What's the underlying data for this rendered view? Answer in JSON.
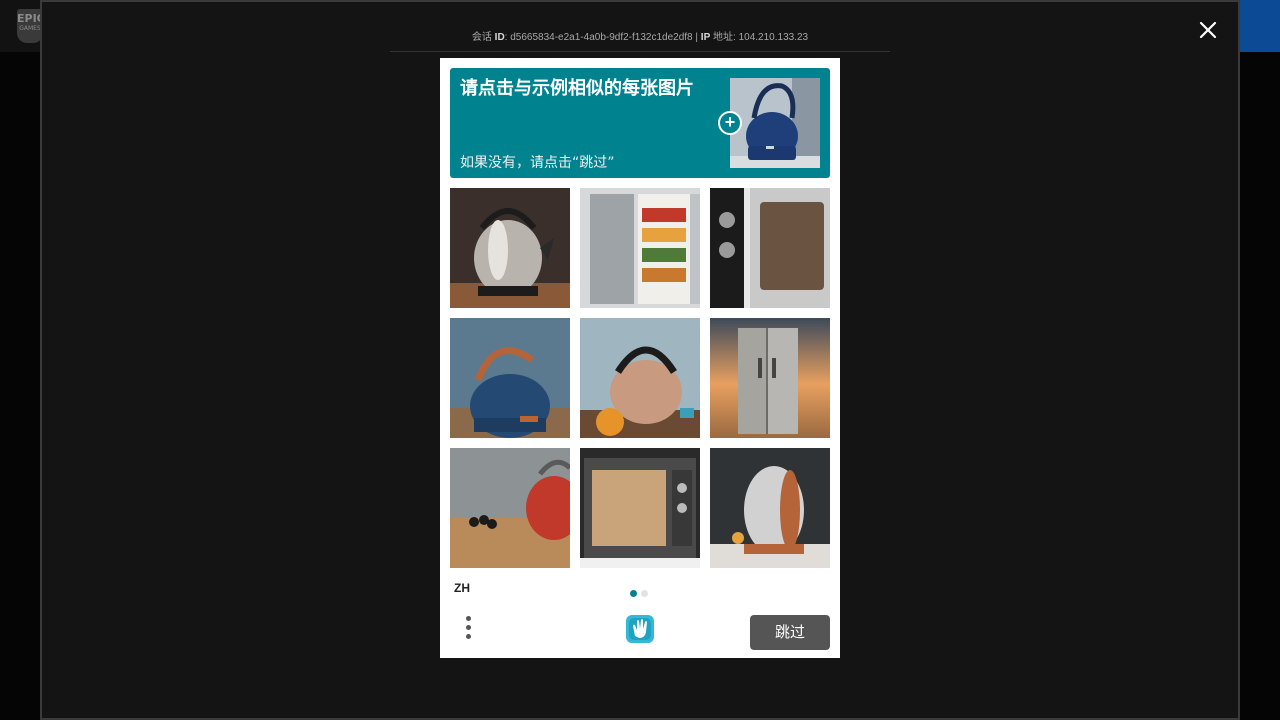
{
  "app": {
    "logo_text": "EPIC",
    "logo_sub": "GAMES"
  },
  "session": {
    "session_label": "会话",
    "id_label": "ID",
    "id_value": "d5665834-e2a1-4a0b-9df2-f132c1de2df8",
    "separator": "|",
    "ip_label": "IP",
    "ip_suffix": "地址",
    "ip_value": "104.210.133.23"
  },
  "captcha": {
    "prompt_title": "请点击与示例相似的每张图片",
    "prompt_subtitle": "如果没有，请点击“跳过”",
    "plus_symbol": "+",
    "language": "ZH",
    "submit_label": "跳过",
    "accent_color": "#00838f",
    "pager": {
      "current_page": 1,
      "total_pages": 2
    },
    "grid": [
      {
        "subject": "stainless kettle"
      },
      {
        "subject": "open refrigerator"
      },
      {
        "subject": "microwave"
      },
      {
        "subject": "blue kettle"
      },
      {
        "subject": "copper kettle"
      },
      {
        "subject": "refrigerator at sunset"
      },
      {
        "subject": "red kettle on board"
      },
      {
        "subject": "microwave front"
      },
      {
        "subject": "kettle with copper trim"
      }
    ]
  },
  "icons": {
    "close": "close-icon",
    "menu": "more-vertical-icon",
    "brand": "hcaptcha-hand-icon"
  }
}
